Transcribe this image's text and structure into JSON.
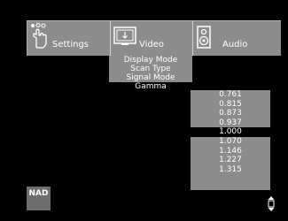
{
  "tabs": {
    "settings": {
      "label": "Settings",
      "icon": "hand-pointer-icon"
    },
    "video": {
      "label": "Video",
      "icon": "display-icon"
    },
    "audio": {
      "label": "Audio",
      "icon": "speaker-icon"
    }
  },
  "video_menu": {
    "items": [
      "Display Mode",
      "Scan Type",
      "Signal Mode",
      "Gamma"
    ],
    "selected": "Gamma"
  },
  "gamma_values": {
    "items": [
      "0.761",
      "0.815",
      "0.873",
      "0.937",
      "1.000",
      "1.070",
      "1.146",
      "1.227",
      "1.315"
    ],
    "selected": "1.000",
    "scroll_icon": "up-down-arrow-icon"
  },
  "logo": {
    "text": "NAD"
  }
}
